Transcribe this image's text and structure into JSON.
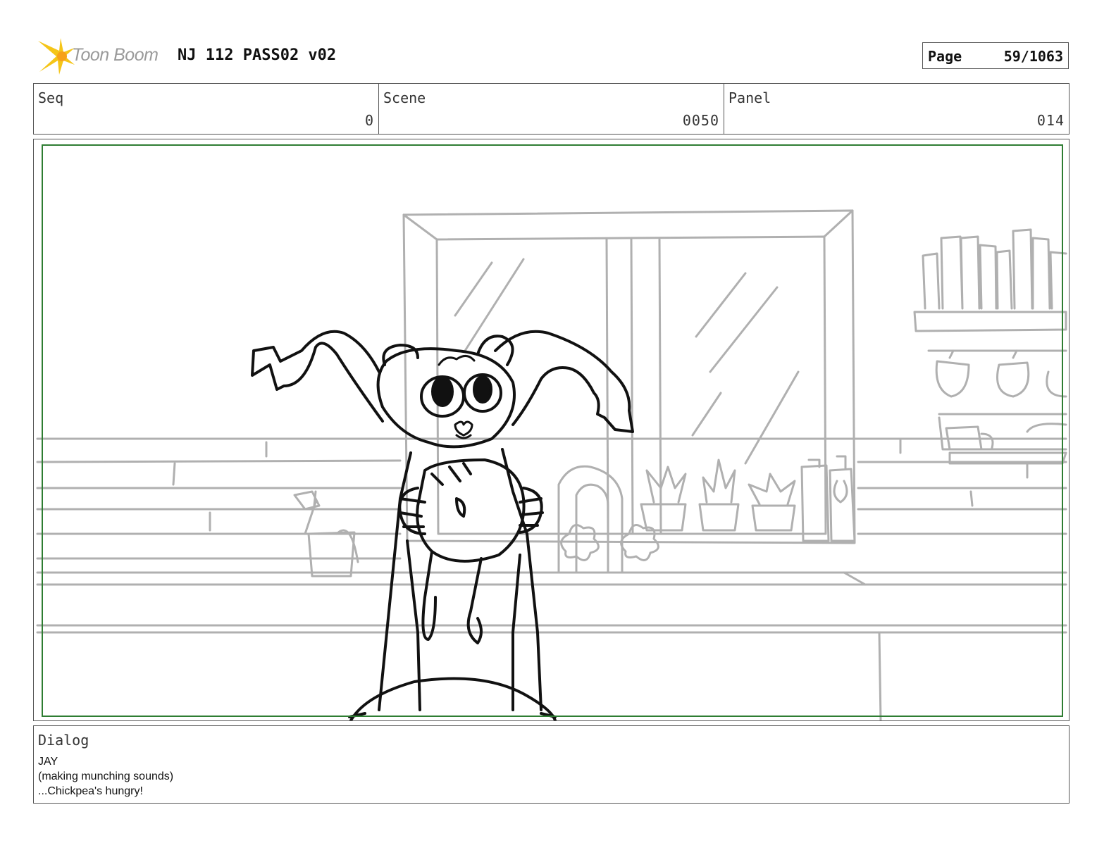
{
  "header": {
    "logo_text": "Toon Boom",
    "project_title": "NJ 112 PASS02 v02",
    "page_label": "Page",
    "page_value": "59/1063"
  },
  "info": {
    "seq_label": "Seq",
    "seq_value": "0",
    "scene_label": "Scene",
    "scene_value": "0050",
    "panel_label": "Panel",
    "panel_value": "014"
  },
  "dialog": {
    "label": "Dialog",
    "lines": [
      "JAY",
      "(making munching sounds)",
      "...Chickpea's hungry!"
    ]
  },
  "colors": {
    "safe_frame": "#2e7d32",
    "sketch_background": "#b0b0b0",
    "sketch_character": "#111111",
    "logo_star": "#f5c518"
  }
}
